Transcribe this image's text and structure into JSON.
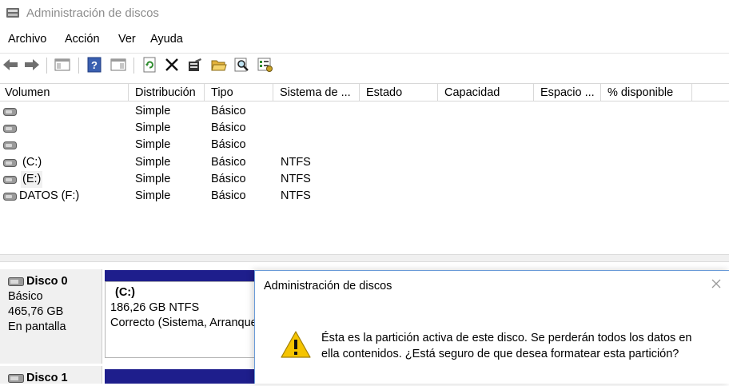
{
  "window": {
    "title": "Administración de discos",
    "icon": "disk-management-icon"
  },
  "menu": {
    "items": [
      "Archivo",
      "Acción",
      "Ver",
      "Ayuda"
    ]
  },
  "toolbar": {
    "buttons": [
      "back-arrow-icon",
      "forward-arrow-icon",
      "console-tree-icon",
      "help-icon",
      "properties-pane-icon",
      "refresh-icon",
      "delete-icon",
      "properties-icon",
      "open-folder-icon",
      "search-icon",
      "settings-icon"
    ]
  },
  "volume_list": {
    "columns": [
      "Volumen",
      "Distribución",
      "Tipo",
      "Sistema de ...",
      "Estado",
      "Capacidad",
      "Espacio ...",
      "% disponible"
    ],
    "rows": [
      {
        "volume": "",
        "layout": "Simple",
        "type": "Básico",
        "fs": ""
      },
      {
        "volume": "",
        "layout": "Simple",
        "type": "Básico",
        "fs": ""
      },
      {
        "volume": "",
        "layout": "Simple",
        "type": "Básico",
        "fs": ""
      },
      {
        "volume": "(C:)",
        "layout": "Simple",
        "type": "Básico",
        "fs": "NTFS"
      },
      {
        "volume": "(E:)",
        "layout": "Simple",
        "type": "Básico",
        "fs": "NTFS"
      },
      {
        "volume": "DATOS (F:)",
        "layout": "Simple",
        "type": "Básico",
        "fs": "NTFS"
      }
    ]
  },
  "disks": [
    {
      "name": "Disco 0",
      "type": "Básico",
      "size": "465,76 GB",
      "status": "En pantalla",
      "partition": {
        "label": "(C:)",
        "size_fs": "186,26 GB NTFS",
        "status": "Correcto (Sistema, Arranque"
      }
    },
    {
      "name": "Disco 1"
    }
  ],
  "dialog": {
    "title": "Administración de discos",
    "message_line1": "Ésta es la partición activa de este disco. Se perderán todos los datos en",
    "message_line2": "ella contenidos. ¿Está seguro de que desea formatear esta partición?",
    "icon": "warning-icon"
  },
  "colors": {
    "partition_bar": "#1e1e8c",
    "title_gray": "#8c8c8c",
    "warning_yellow": "#f5c400"
  }
}
